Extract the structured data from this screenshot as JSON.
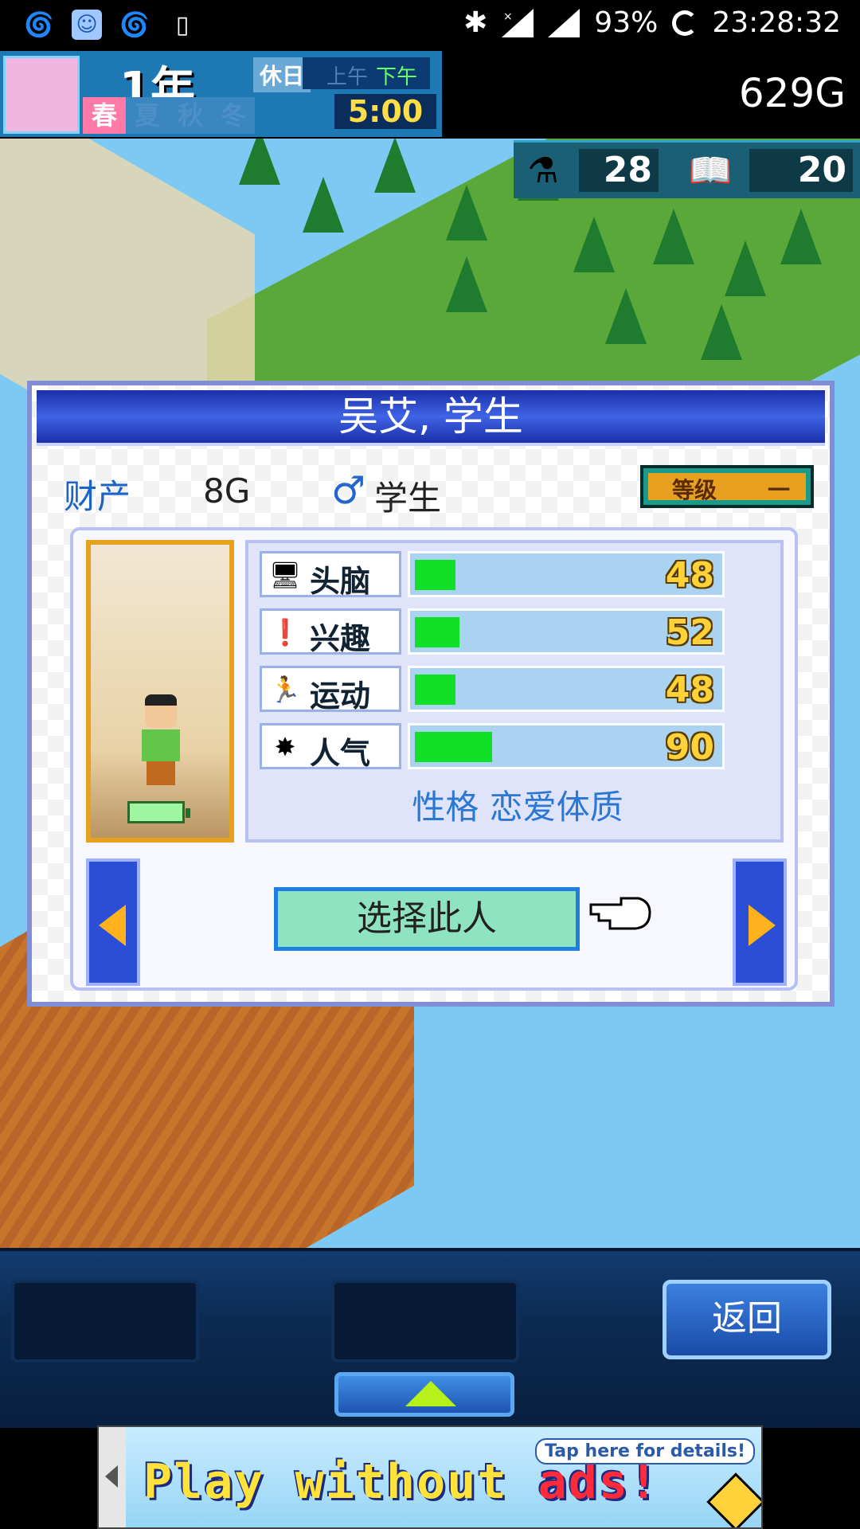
{
  "status_bar": {
    "battery_percent": "93%",
    "time": "23:28:32",
    "icons": [
      "swirl-icon",
      "app-icon",
      "swirl-icon",
      "phone-icon",
      "bluetooth-icon",
      "no-signal-icon",
      "signal-icon",
      "loading-icon"
    ]
  },
  "hud": {
    "year": "1年",
    "holiday": "休日",
    "am": "上午",
    "pm": "下午",
    "clock": "5:00",
    "seasons": [
      "春",
      "夏",
      "秋",
      "冬"
    ],
    "active_season": "春",
    "money": "629G",
    "resources": [
      {
        "icon": "flask-icon",
        "value": "28"
      },
      {
        "icon": "book-icon",
        "value": "20"
      }
    ]
  },
  "dialog": {
    "title": "吴艾, 学生",
    "property_label": "财产",
    "property_value": "8G",
    "occupation": "学生",
    "rank_label": "等级",
    "rank_value": "一",
    "stats": [
      {
        "name": "头脑",
        "icon": "brain-icon",
        "value": 48
      },
      {
        "name": "兴趣",
        "icon": "interest-icon",
        "value": 52
      },
      {
        "name": "运动",
        "icon": "sport-icon",
        "value": 48
      },
      {
        "name": "人气",
        "icon": "popularity-icon",
        "value": 90
      }
    ],
    "personality": "性格 恋爱体质",
    "select_button": "选择此人"
  },
  "bottom": {
    "back_button": "返回"
  },
  "ad": {
    "text_main": "Play without ",
    "text_red": "ads!",
    "detail": "Tap here for details!"
  }
}
